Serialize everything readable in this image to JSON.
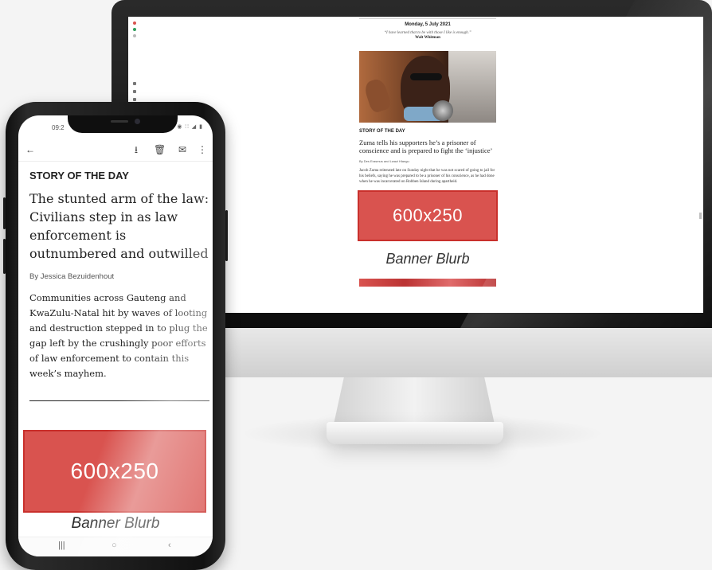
{
  "desktop": {
    "date": "Monday, 5 July 2021",
    "quote": "“I have learned that to be with those I like is enough.”",
    "quote_author": "Walt Whitman",
    "eyebrow": "STORY OF THE DAY",
    "headline": "Zuma tells his supporters he’s a prisoner of conscience and is prepared to fight the ‘injustice’",
    "byline": "By Des Erasmus and Lwazi Hlangu",
    "body": "Jacob Zuma reiterated late on Sunday night that he was not scared of going to jail for his beliefs, saying he was prepared to be a prisoner of his conscience, as he had done when he was incarcerated on Robben Island during apartheid.",
    "banner_label": "600x250",
    "banner_blurb": "Banner Blurb"
  },
  "phone": {
    "time": "09:2",
    "status_icons": "✳ ◉ ∷ ◢ ▮",
    "appbar": {
      "back_icon": "←",
      "archive_icon": "⭳",
      "delete_icon": "🗑",
      "mail_icon": "✉",
      "more_icon": "⋮"
    },
    "eyebrow": "STORY OF THE DAY",
    "headline": "The stunted arm of the law: Civilians step in as law enforcement is outnumbered and outwilled",
    "byline": "By Jessica Bezuidenhout",
    "body": "Communities across Gauteng and KwaZulu-Natal hit by waves of looting and destruction stepped in to plug the gap left by the crushingly poor efforts of law enforcement to contain this week’s mayhem.",
    "banner_label": "600x250",
    "banner_blurb": "Banner Blurb",
    "nav": {
      "recents_icon": "|||",
      "home_icon": "○",
      "back_icon": "‹"
    }
  },
  "colors": {
    "banner": "#d9534f",
    "banner_border": "#c9302c"
  }
}
